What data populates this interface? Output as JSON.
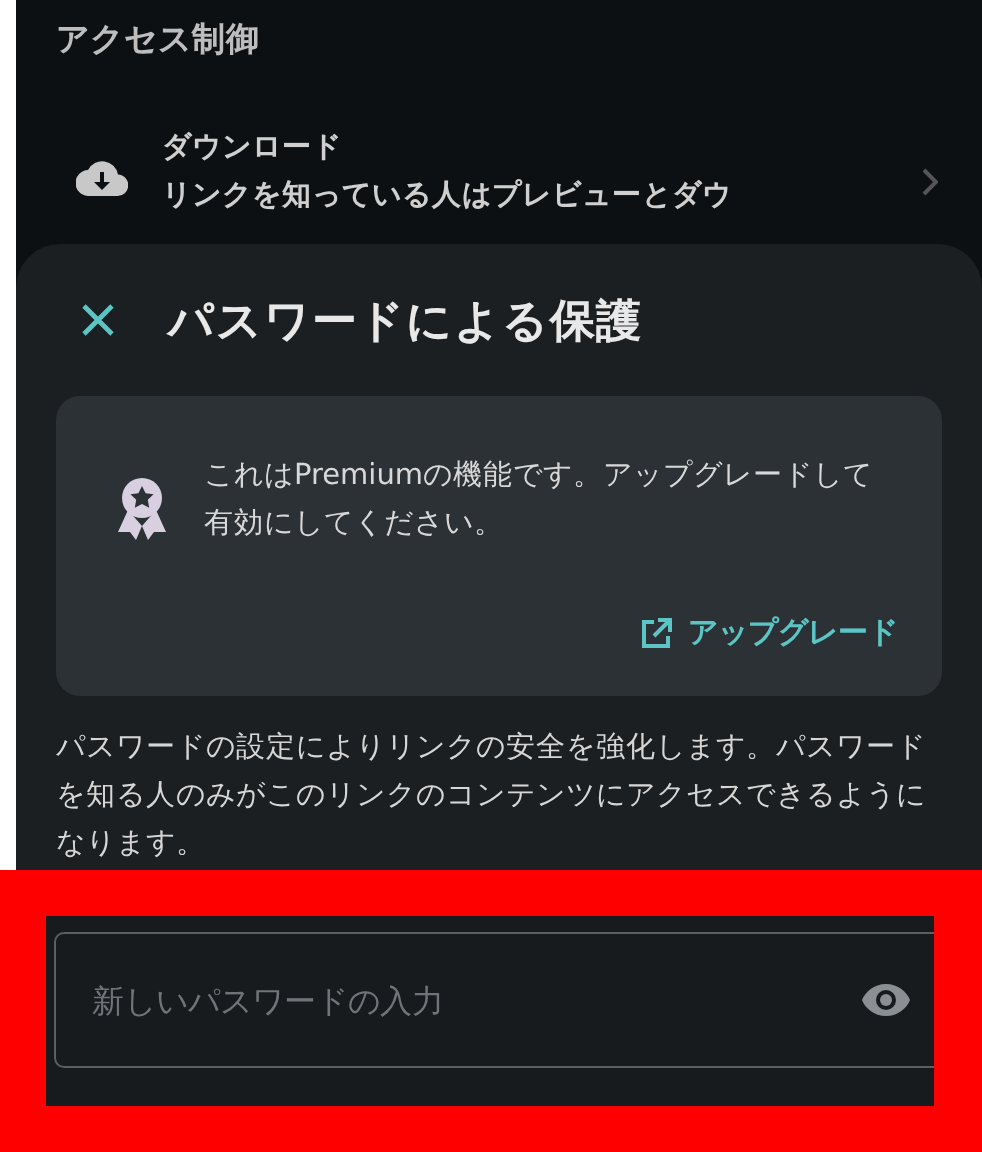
{
  "section": {
    "title": "アクセス制御"
  },
  "settings": [
    {
      "kind": "download",
      "title": "ダウンロード",
      "description": "リンクを知っている人はプレビューとダウ"
    }
  ],
  "sheet": {
    "title": "パスワードによる保護",
    "notice": {
      "text": "これはPremiumの機能です。アップグレードして有効にしてください。",
      "link": "アップグレード"
    },
    "description": "パスワードの設定によりリンクの安全を強化します。パスワードを知る人のみがこのリンクのコンテンツにアクセスできるようになります。",
    "password_field": {
      "placeholder": "新しいパスワードの入力",
      "highlighted": true
    }
  }
}
